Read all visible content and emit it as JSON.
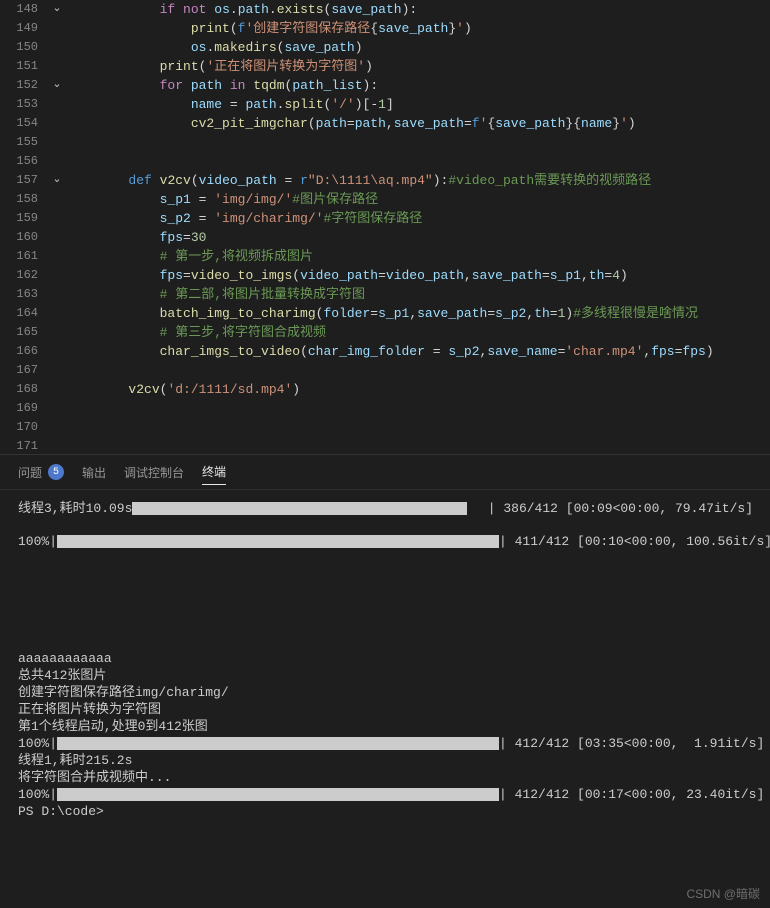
{
  "gutter": {
    "start": 148,
    "end": 171,
    "folds": {
      "148": true,
      "152": true,
      "157": true
    }
  },
  "code": [
    [
      [
        "",
        8
      ],
      [
        "kc",
        "if"
      ],
      [
        "p",
        " "
      ],
      [
        "kc",
        "not"
      ],
      [
        "p",
        " "
      ],
      [
        "v",
        "os"
      ],
      [
        "p",
        "."
      ],
      [
        "v",
        "path"
      ],
      [
        "p",
        "."
      ],
      [
        "fn",
        "exists"
      ],
      [
        "p",
        "("
      ],
      [
        "v",
        "save_path"
      ],
      [
        "p",
        "):"
      ]
    ],
    [
      [
        "",
        12
      ],
      [
        "fn",
        "print"
      ],
      [
        "p",
        "("
      ],
      [
        "sb",
        "f"
      ],
      [
        "s",
        "'创建字符图保存路径"
      ],
      [
        "p",
        "{"
      ],
      [
        "sv",
        "save_path"
      ],
      [
        "p",
        "}"
      ],
      [
        "s",
        "'"
      ],
      [
        "p",
        ")"
      ]
    ],
    [
      [
        "",
        12
      ],
      [
        "v",
        "os"
      ],
      [
        "p",
        "."
      ],
      [
        "fn",
        "makedirs"
      ],
      [
        "p",
        "("
      ],
      [
        "v",
        "save_path"
      ],
      [
        "p",
        ")"
      ]
    ],
    [
      [
        "",
        8
      ],
      [
        "fn",
        "print"
      ],
      [
        "p",
        "("
      ],
      [
        "s",
        "'正在将图片转换为字符图'"
      ],
      [
        "p",
        ")"
      ]
    ],
    [
      [
        "",
        8
      ],
      [
        "kc",
        "for"
      ],
      [
        "p",
        " "
      ],
      [
        "v",
        "path"
      ],
      [
        "p",
        " "
      ],
      [
        "kc",
        "in"
      ],
      [
        "p",
        " "
      ],
      [
        "fn",
        "tqdm"
      ],
      [
        "p",
        "("
      ],
      [
        "v",
        "path_list"
      ],
      [
        "p",
        "):"
      ]
    ],
    [
      [
        "",
        12
      ],
      [
        "v",
        "name"
      ],
      [
        "p",
        " = "
      ],
      [
        "v",
        "path"
      ],
      [
        "p",
        "."
      ],
      [
        "fn",
        "split"
      ],
      [
        "p",
        "("
      ],
      [
        "s",
        "'/'"
      ],
      [
        "p",
        ")[-"
      ],
      [
        "n",
        "1"
      ],
      [
        "p",
        "]"
      ]
    ],
    [
      [
        "",
        12
      ],
      [
        "fn",
        "cv2_pit_imgchar"
      ],
      [
        "p",
        "("
      ],
      [
        "v",
        "path"
      ],
      [
        "p",
        "="
      ],
      [
        "v",
        "path"
      ],
      [
        "p",
        ","
      ],
      [
        "v",
        "save_path"
      ],
      [
        "p",
        "="
      ],
      [
        "sb",
        "f"
      ],
      [
        "s",
        "'"
      ],
      [
        "p",
        "{"
      ],
      [
        "sv",
        "save_path"
      ],
      [
        "p",
        "}{"
      ],
      [
        "sv",
        "name"
      ],
      [
        "p",
        "}"
      ],
      [
        "s",
        "'"
      ],
      [
        "p",
        ")"
      ]
    ],
    [],
    [],
    [
      [
        "",
        4
      ],
      [
        "k",
        "def"
      ],
      [
        "p",
        " "
      ],
      [
        "fn",
        "v2cv"
      ],
      [
        "p",
        "("
      ],
      [
        "v",
        "video_path"
      ],
      [
        "p",
        " = "
      ],
      [
        "sb",
        "r"
      ],
      [
        "s",
        "\"D:\\1111\\aq.mp4\""
      ],
      [
        "p",
        "):"
      ],
      [
        "c",
        "#video_path需要转换的视频路径"
      ]
    ],
    [
      [
        "",
        8
      ],
      [
        "v",
        "s_p1"
      ],
      [
        "p",
        " = "
      ],
      [
        "s",
        "'img/img/'"
      ],
      [
        "c",
        "#图片保存路径"
      ]
    ],
    [
      [
        "",
        8
      ],
      [
        "v",
        "s_p2"
      ],
      [
        "p",
        " = "
      ],
      [
        "s",
        "'img/charimg/'"
      ],
      [
        "c",
        "#字符图保存路径"
      ]
    ],
    [
      [
        "",
        8
      ],
      [
        "v",
        "fps"
      ],
      [
        "p",
        "="
      ],
      [
        "n",
        "30"
      ]
    ],
    [
      [
        "",
        8
      ],
      [
        "c",
        "# 第一步,将视频拆成图片"
      ]
    ],
    [
      [
        "",
        8
      ],
      [
        "v",
        "fps"
      ],
      [
        "p",
        "="
      ],
      [
        "fn",
        "video_to_imgs"
      ],
      [
        "p",
        "("
      ],
      [
        "v",
        "video_path"
      ],
      [
        "p",
        "="
      ],
      [
        "v",
        "video_path"
      ],
      [
        "p",
        ","
      ],
      [
        "v",
        "save_path"
      ],
      [
        "p",
        "="
      ],
      [
        "v",
        "s_p1"
      ],
      [
        "p",
        ","
      ],
      [
        "v",
        "th"
      ],
      [
        "p",
        "="
      ],
      [
        "n",
        "4"
      ],
      [
        "p",
        ")"
      ]
    ],
    [
      [
        "",
        8
      ],
      [
        "c",
        "# 第二部,将图片批量转换成字符图"
      ]
    ],
    [
      [
        "",
        8
      ],
      [
        "fn",
        "batch_img_to_charimg"
      ],
      [
        "p",
        "("
      ],
      [
        "v",
        "folder"
      ],
      [
        "p",
        "="
      ],
      [
        "v",
        "s_p1"
      ],
      [
        "p",
        ","
      ],
      [
        "v",
        "save_path"
      ],
      [
        "p",
        "="
      ],
      [
        "v",
        "s_p2"
      ],
      [
        "p",
        ","
      ],
      [
        "v",
        "th"
      ],
      [
        "p",
        "="
      ],
      [
        "n",
        "1"
      ],
      [
        "p",
        ")"
      ],
      [
        "c",
        "#多线程很慢是啥情况"
      ]
    ],
    [
      [
        "",
        8
      ],
      [
        "c",
        "# 第三步,将字符图合成视频"
      ]
    ],
    [
      [
        "",
        8
      ],
      [
        "fn",
        "char_imgs_to_video"
      ],
      [
        "p",
        "("
      ],
      [
        "v",
        "char_img_folder"
      ],
      [
        "p",
        " = "
      ],
      [
        "v",
        "s_p2"
      ],
      [
        "p",
        ","
      ],
      [
        "v",
        "save_name"
      ],
      [
        "p",
        "="
      ],
      [
        "s",
        "'char.mp4'"
      ],
      [
        "p",
        ","
      ],
      [
        "v",
        "fps"
      ],
      [
        "p",
        "="
      ],
      [
        "v",
        "fps"
      ],
      [
        "p",
        ")"
      ]
    ],
    [],
    [
      [
        "",
        4
      ],
      [
        "fn",
        "v2cv"
      ],
      [
        "p",
        "("
      ],
      [
        "s",
        "'d:/1111/sd.mp4'"
      ],
      [
        "p",
        ")"
      ]
    ],
    [],
    [],
    []
  ],
  "tabs": {
    "problems": "问题",
    "problems_count": "5",
    "output": "输出",
    "debug": "调试控制台",
    "terminal": "终端"
  },
  "terminal": {
    "rows": [
      {
        "type": "prog",
        "label": "线程3,耗时10.09s",
        "bar": 335,
        "stat": "| 386/412 [00:09<00:00, 79.47it/s]",
        "gap": 27
      },
      {
        "type": "blank",
        "h": 16
      },
      {
        "type": "prog",
        "label": "100%|",
        "bar": 442,
        "stat": "| 411/412 [00:10<00:00, 100.56it/s]",
        "gap": 20
      },
      {
        "type": "blank",
        "h": 100
      },
      {
        "type": "text",
        "text": "aaaaaaaaaaaa"
      },
      {
        "type": "text",
        "text": "总共412张图片"
      },
      {
        "type": "text",
        "text": "创建字符图保存路径img/charimg/"
      },
      {
        "type": "text",
        "text": "正在将图片转换为字符图"
      },
      {
        "type": "text",
        "text": "第1个线程启动,处理0到412张图"
      },
      {
        "type": "prog",
        "label": "100%|",
        "bar": 442,
        "stat": "| 412/412 [03:35<00:00,  1.91it/s]",
        "gap": 27
      },
      {
        "type": "text",
        "text": "线程1,耗时215.2s"
      },
      {
        "type": "text",
        "text": "将字符图合并成视频中..."
      },
      {
        "type": "prog",
        "label": "100%|",
        "bar": 442,
        "stat": "| 412/412 [00:17<00:00, 23.40it/s]",
        "gap": 27
      },
      {
        "type": "text",
        "text": "PS D:\\code>"
      }
    ]
  },
  "watermark": "CSDN @暗碳"
}
